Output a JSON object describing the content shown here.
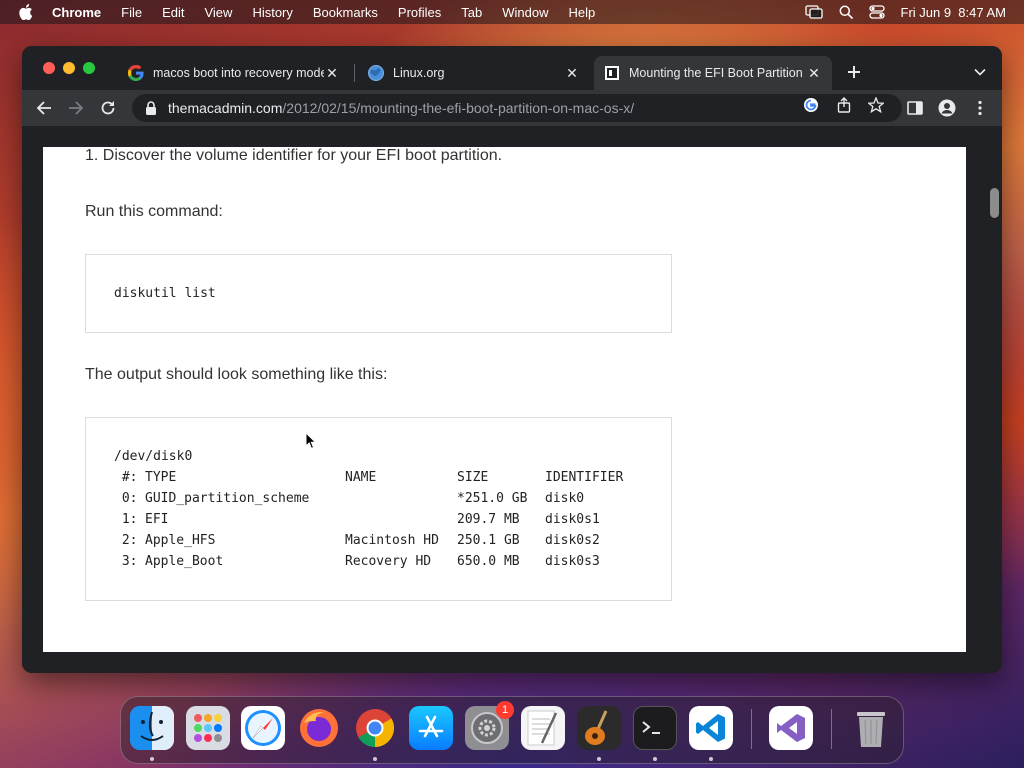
{
  "menubar": {
    "app_name": "Chrome",
    "items": [
      "File",
      "Edit",
      "View",
      "History",
      "Bookmarks",
      "Profiles",
      "Tab",
      "Window",
      "Help"
    ],
    "datetime": "Fri Jun 9  8:47 AM"
  },
  "tabs": [
    {
      "title": "macos boot into recovery mode",
      "favicon": "google-icon",
      "active": false
    },
    {
      "title": "Linux.org",
      "favicon": "linux-org-icon",
      "active": false
    },
    {
      "title": "Mounting the EFI Boot Partition",
      "favicon": "themacadmin-icon",
      "active": true
    }
  ],
  "toolbar": {
    "url_host": "themacadmin.com",
    "url_path": "/2012/02/15/mounting-the-efi-boot-partition-on-mac-os-x/"
  },
  "article": {
    "step1": "1. Discover the volume identifier for your EFI boot partition.",
    "run_command": "Run this command:",
    "command": "diskutil list",
    "output_intro": "The output should look something like this:",
    "output": {
      "device": "/dev/disk0",
      "headers": {
        "num": " #:",
        "type": "TYPE",
        "name": "NAME",
        "size": "SIZE",
        "identifier": "IDENTIFIER"
      },
      "rows": [
        {
          "num": " 0:",
          "type": "GUID_partition_scheme",
          "name": "",
          "size": "*251.0 GB",
          "identifier": "disk0"
        },
        {
          "num": " 1:",
          "type": "EFI",
          "name": "",
          "size": "209.7 MB",
          "identifier": "disk0s1"
        },
        {
          "num": " 2:",
          "type": "Apple_HFS",
          "name": "Macintosh HD",
          "size": "250.1 GB",
          "identifier": "disk0s2"
        },
        {
          "num": " 3:",
          "type": "Apple_Boot",
          "name": "Recovery HD",
          "size": "650.0 MB",
          "identifier": "disk0s3"
        }
      ]
    }
  },
  "dock": {
    "apps": [
      "Finder",
      "Launchpad",
      "Safari",
      "Firefox",
      "Chrome",
      "App Store",
      "System Preferences",
      "TextEdit",
      "GarageBand",
      "Terminal",
      "VS Code",
      "Visual Studio",
      "Trash"
    ],
    "settings_badge": "1"
  }
}
